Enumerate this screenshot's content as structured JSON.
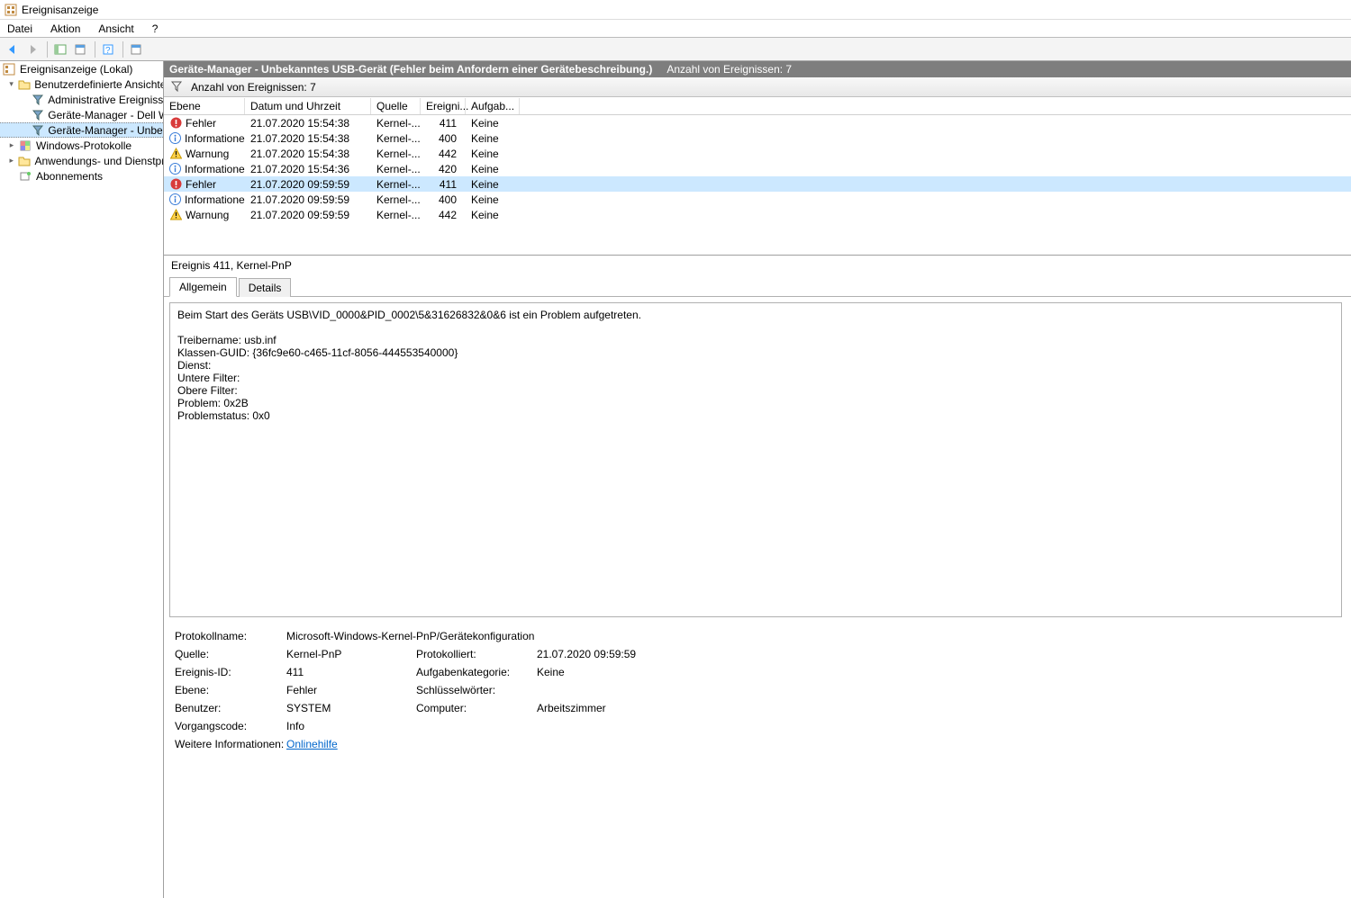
{
  "window": {
    "title": "Ereignisanzeige"
  },
  "menu": {
    "file": "Datei",
    "action": "Aktion",
    "view": "Ansicht",
    "help": "?"
  },
  "tree": {
    "root": "Ereignisanzeige (Lokal)",
    "custom_views": "Benutzerdefinierte Ansichten",
    "admin_events": "Administrative Ereignisse",
    "dev_dell": "Geräte-Manager - Dell W",
    "dev_unknown": "Geräte-Manager - Unbek",
    "windows_logs": "Windows-Protokolle",
    "app_service_logs": "Anwendungs- und Dienstpro",
    "subscriptions": "Abonnements"
  },
  "header": {
    "title": "Geräte-Manager - Unbekanntes USB-Gerät (Fehler beim Anfordern einer Gerätebeschreibung.)",
    "count_label": "Anzahl von Ereignissen: 7"
  },
  "filterbar": {
    "count_label": "Anzahl von Ereignissen: 7"
  },
  "columns": {
    "level": "Ebene",
    "datetime": "Datum und Uhrzeit",
    "source": "Quelle",
    "eventid": "Ereigni...",
    "taskcat": "Aufgab..."
  },
  "events": [
    {
      "level": "Fehler",
      "icon": "error",
      "datetime": "21.07.2020 15:54:38",
      "source": "Kernel-...",
      "id": 411,
      "task": "Keine"
    },
    {
      "level": "Informationen",
      "icon": "info",
      "datetime": "21.07.2020 15:54:38",
      "source": "Kernel-...",
      "id": 400,
      "task": "Keine"
    },
    {
      "level": "Warnung",
      "icon": "warn",
      "datetime": "21.07.2020 15:54:38",
      "source": "Kernel-...",
      "id": 442,
      "task": "Keine"
    },
    {
      "level": "Informationen",
      "icon": "info",
      "datetime": "21.07.2020 15:54:36",
      "source": "Kernel-...",
      "id": 420,
      "task": "Keine"
    },
    {
      "level": "Fehler",
      "icon": "error",
      "datetime": "21.07.2020 09:59:59",
      "source": "Kernel-...",
      "id": 411,
      "task": "Keine",
      "selected": true
    },
    {
      "level": "Informationen",
      "icon": "info",
      "datetime": "21.07.2020 09:59:59",
      "source": "Kernel-...",
      "id": 400,
      "task": "Keine"
    },
    {
      "level": "Warnung",
      "icon": "warn",
      "datetime": "21.07.2020 09:59:59",
      "source": "Kernel-...",
      "id": 442,
      "task": "Keine"
    }
  ],
  "detail": {
    "title": "Ereignis 411, Kernel-PnP",
    "tabs": {
      "general": "Allgemein",
      "details": "Details"
    },
    "message": "Beim Start des Geräts USB\\VID_0000&PID_0002\\5&31626832&0&6 ist ein Problem aufgetreten.\n\nTreibername: usb.inf\nKlassen-GUID: {36fc9e60-c465-11cf-8056-444553540000}\nDienst: \nUntere Filter: \nObere Filter: \nProblem: 0x2B\nProblemstatus: 0x0",
    "props": {
      "log_name_label": "Protokollname:",
      "log_name": "Microsoft-Windows-Kernel-PnP/Gerätekonfiguration",
      "source_label": "Quelle:",
      "source": "Kernel-PnP",
      "logged_label": "Protokolliert:",
      "logged": "21.07.2020 09:59:59",
      "eventid_label": "Ereignis-ID:",
      "eventid": "411",
      "taskcat_label": "Aufgabenkategorie:",
      "taskcat": "Keine",
      "level_label": "Ebene:",
      "level": "Fehler",
      "keywords_label": "Schlüsselwörter:",
      "keywords": "",
      "user_label": "Benutzer:",
      "user": "SYSTEM",
      "computer_label": "Computer:",
      "computer": "Arbeitszimmer",
      "opcode_label": "Vorgangscode:",
      "opcode": "Info",
      "moreinfo_label": "Weitere Informationen:",
      "moreinfo_link": "Onlinehilfe"
    }
  }
}
